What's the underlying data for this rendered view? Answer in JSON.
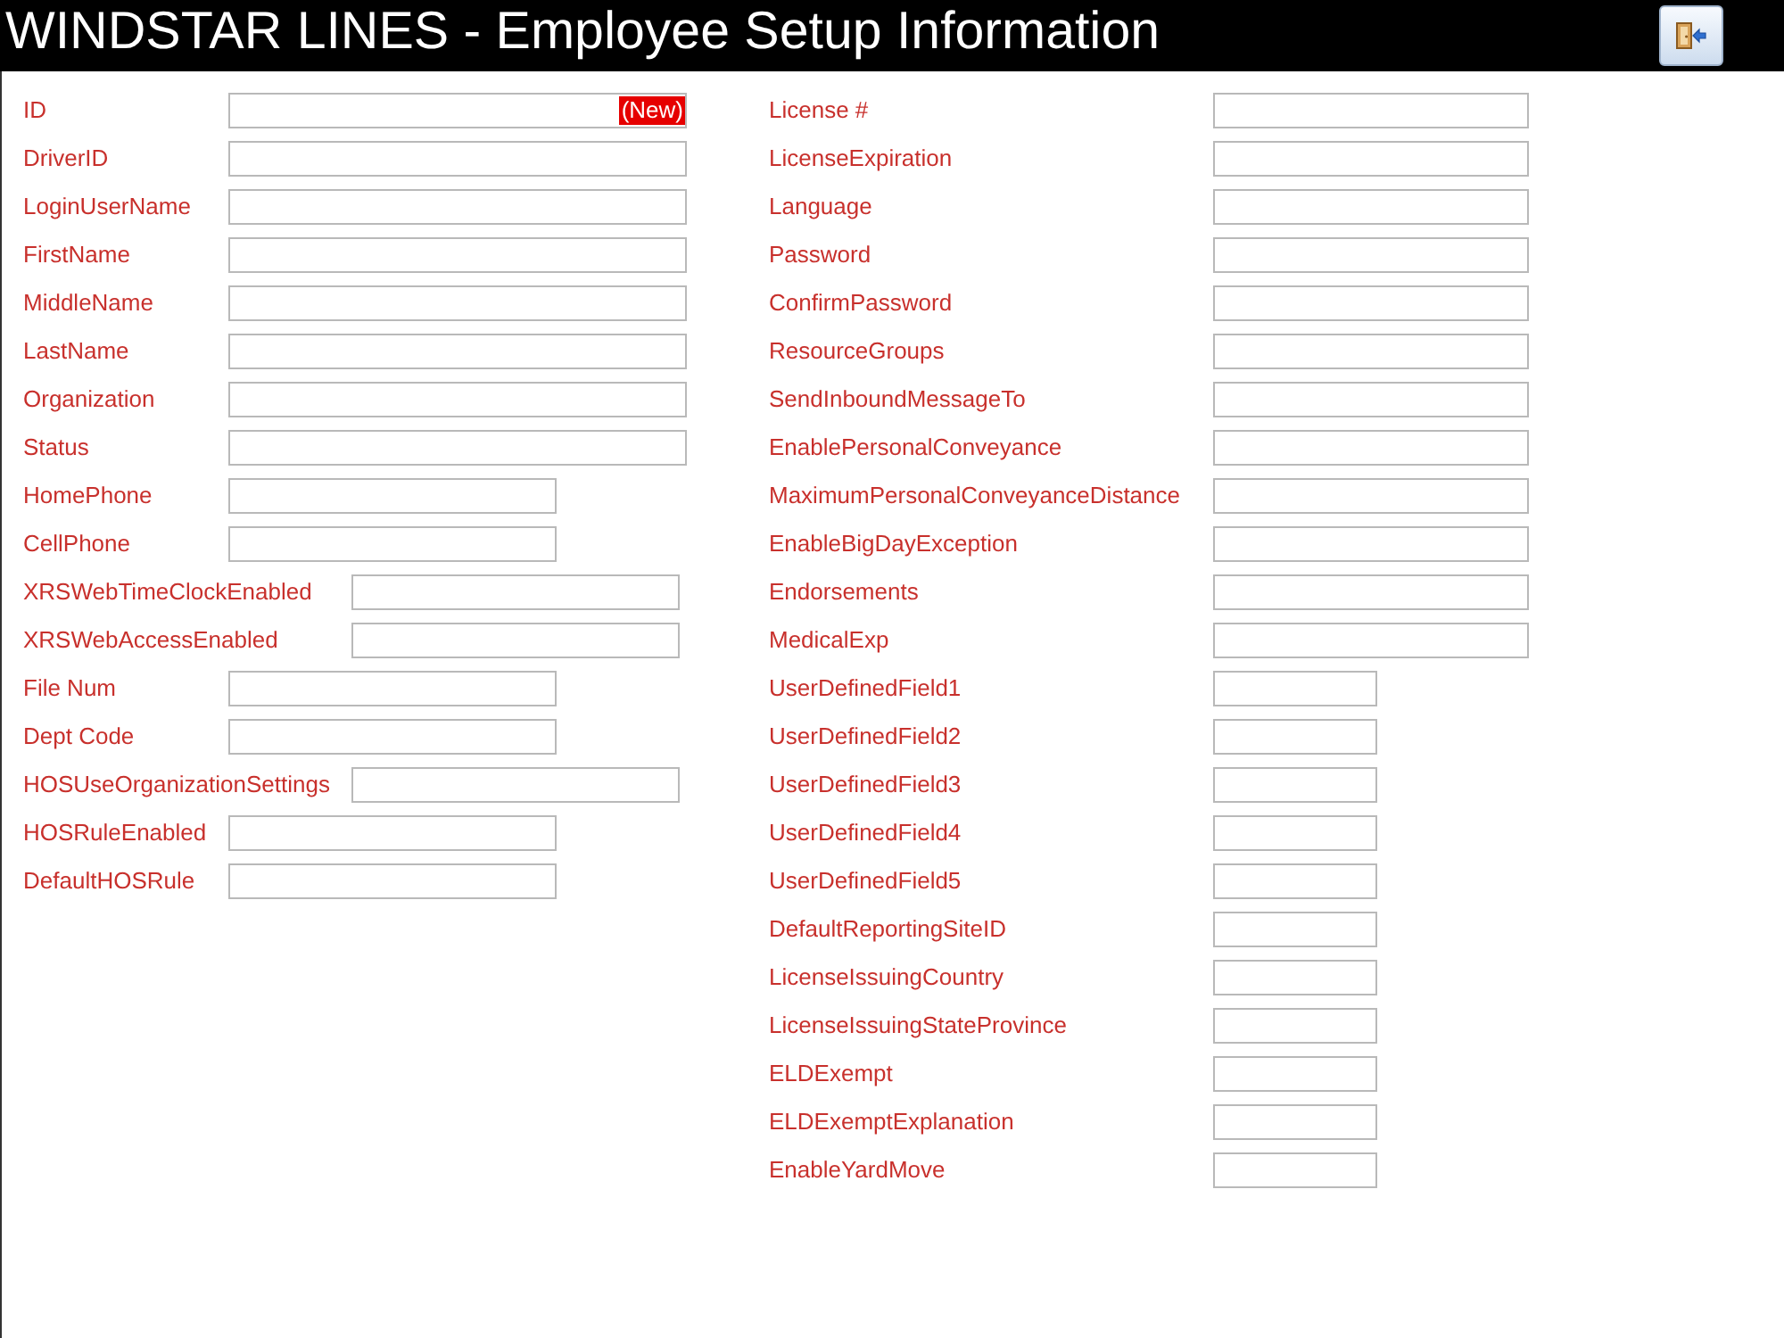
{
  "header": {
    "title": "WINDSTAR LINES - Employee Setup Information"
  },
  "form": {
    "left_column": [
      {
        "label": "ID",
        "kind": "wide",
        "value": "(New)",
        "value_selected": true
      },
      {
        "label": "DriverID",
        "kind": "wide"
      },
      {
        "label": "LoginUserName",
        "kind": "wide"
      },
      {
        "label": "FirstName",
        "kind": "wide"
      },
      {
        "label": "MiddleName",
        "kind": "wide"
      },
      {
        "label": "LastName",
        "kind": "wide"
      },
      {
        "label": "Organization",
        "kind": "wide"
      },
      {
        "label": "Status",
        "kind": "wide"
      },
      {
        "label": "HomePhone",
        "kind": "short"
      },
      {
        "label": "CellPhone",
        "kind": "short"
      },
      {
        "label": "XRSWebTimeClockEnabled",
        "kind": "offset"
      },
      {
        "label": "XRSWebAccessEnabled",
        "kind": "offset"
      },
      {
        "label": "File Num",
        "kind": "short"
      },
      {
        "label": "Dept Code",
        "kind": "short"
      },
      {
        "label": "HOSUseOrganizationSettings",
        "kind": "offset"
      },
      {
        "label": "HOSRuleEnabled",
        "kind": "short"
      },
      {
        "label": "DefaultHOSRule",
        "kind": "short"
      }
    ],
    "right_column": [
      {
        "label": "License #",
        "kind": "wide"
      },
      {
        "label": "LicenseExpiration",
        "kind": "wide"
      },
      {
        "label": "Language",
        "kind": "wide"
      },
      {
        "label": "Password",
        "kind": "wide"
      },
      {
        "label": "ConfirmPassword",
        "kind": "wide"
      },
      {
        "label": "ResourceGroups",
        "kind": "wide"
      },
      {
        "label": "SendInboundMessageTo",
        "kind": "wide"
      },
      {
        "label": "EnablePersonalConveyance",
        "kind": "wide"
      },
      {
        "label": "MaximumPersonalConveyanceDistance",
        "kind": "wide"
      },
      {
        "label": "EnableBigDayException",
        "kind": "wide"
      },
      {
        "label": "Endorsements",
        "kind": "wide"
      },
      {
        "label": "MedicalExp",
        "kind": "wide"
      },
      {
        "label": "UserDefinedField1",
        "kind": "short"
      },
      {
        "label": "UserDefinedField2",
        "kind": "short"
      },
      {
        "label": "UserDefinedField3",
        "kind": "short"
      },
      {
        "label": "UserDefinedField4",
        "kind": "short"
      },
      {
        "label": "UserDefinedField5",
        "kind": "short"
      },
      {
        "label": "DefaultReportingSiteID",
        "kind": "short"
      },
      {
        "label": "LicenseIssuingCountry",
        "kind": "short"
      },
      {
        "label": "LicenseIssuingStateProvince",
        "kind": "short"
      },
      {
        "label": "ELDExempt",
        "kind": "short"
      },
      {
        "label": "ELDExemptExplanation",
        "kind": "short"
      },
      {
        "label": "EnableYardMove",
        "kind": "short"
      }
    ]
  }
}
